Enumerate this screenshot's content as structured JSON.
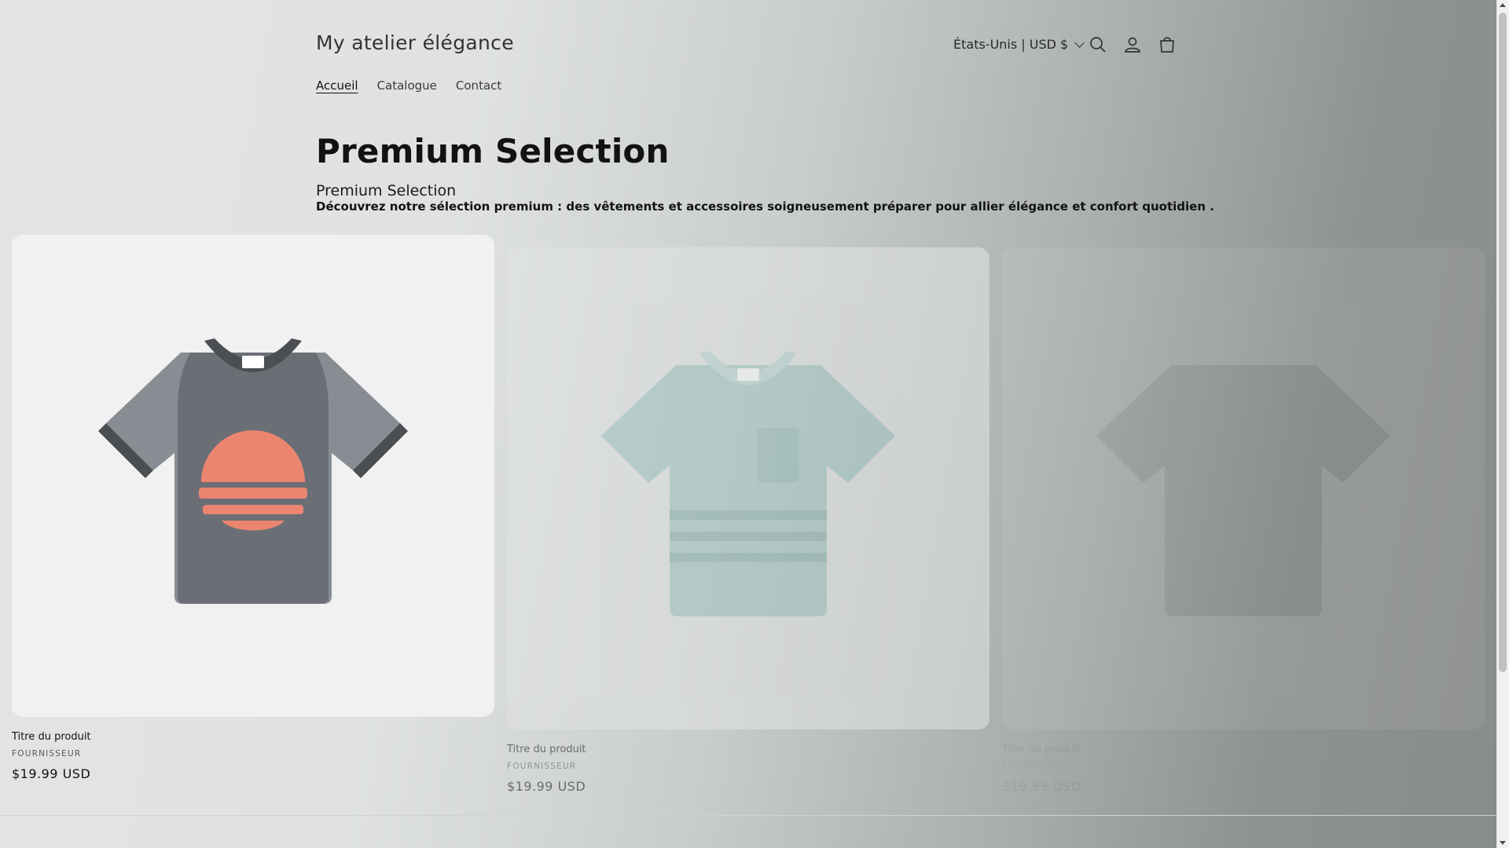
{
  "header": {
    "logo": "My atelier élégance",
    "nav": [
      {
        "label": "Accueil",
        "active": true
      },
      {
        "label": "Catalogue",
        "active": false
      },
      {
        "label": "Contact",
        "active": false
      }
    ],
    "locale": "États-Unis | USD $",
    "icons": [
      "search-icon",
      "account-icon",
      "cart-icon"
    ]
  },
  "main": {
    "title": "Premium Selection",
    "subtitle": "Premium Selection",
    "description": "Découvrez notre sélection premium : des vêtements et accessoires soigneusement préparer pour allier élégance et confort quotidien ."
  },
  "products": [
    {
      "title": "Titre du produit",
      "vendor": "FOURNISSEUR",
      "price": "$19.99 USD"
    },
    {
      "title": "Titre du produit",
      "vendor": "FOURNISSEUR",
      "price": "$19.99 USD"
    },
    {
      "title": "Titre du produit",
      "vendor": "FOURNISSEUR",
      "price": "$19.99 USD"
    }
  ],
  "colors": {
    "shirt_dark": "#6b6f75",
    "shirt_sleeve": "#888d94",
    "shirt_trim": "#4b4e52",
    "sun": "#ec8570",
    "shirt_teal": "#9fc5c2",
    "card_bg": "#f1f1f1"
  }
}
